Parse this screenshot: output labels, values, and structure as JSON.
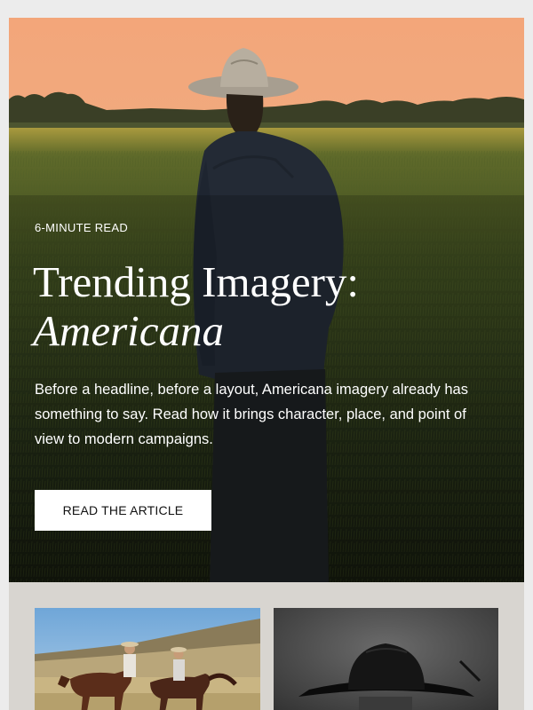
{
  "hero": {
    "eyebrow": "6-MINUTE READ",
    "title_line1": "Trending Imagery:",
    "title_line2": "Americana",
    "description": "Before a headline, before a layout, Americana imagery already has something to say. Read how it brings character, place, and point of view to modern campaigns.",
    "cta_label": "READ THE ARTICLE"
  },
  "cards": [
    {
      "subject": "horseback-riders-photo"
    },
    {
      "subject": "black-cowboy-hat-portrait-photo"
    }
  ],
  "colors": {
    "sky_top": "#f2a77b",
    "sky_bottom": "#e9b389",
    "field": "#3b4a1e",
    "cta_bg": "#ffffff",
    "frame_bg": "#d8d5d0"
  }
}
